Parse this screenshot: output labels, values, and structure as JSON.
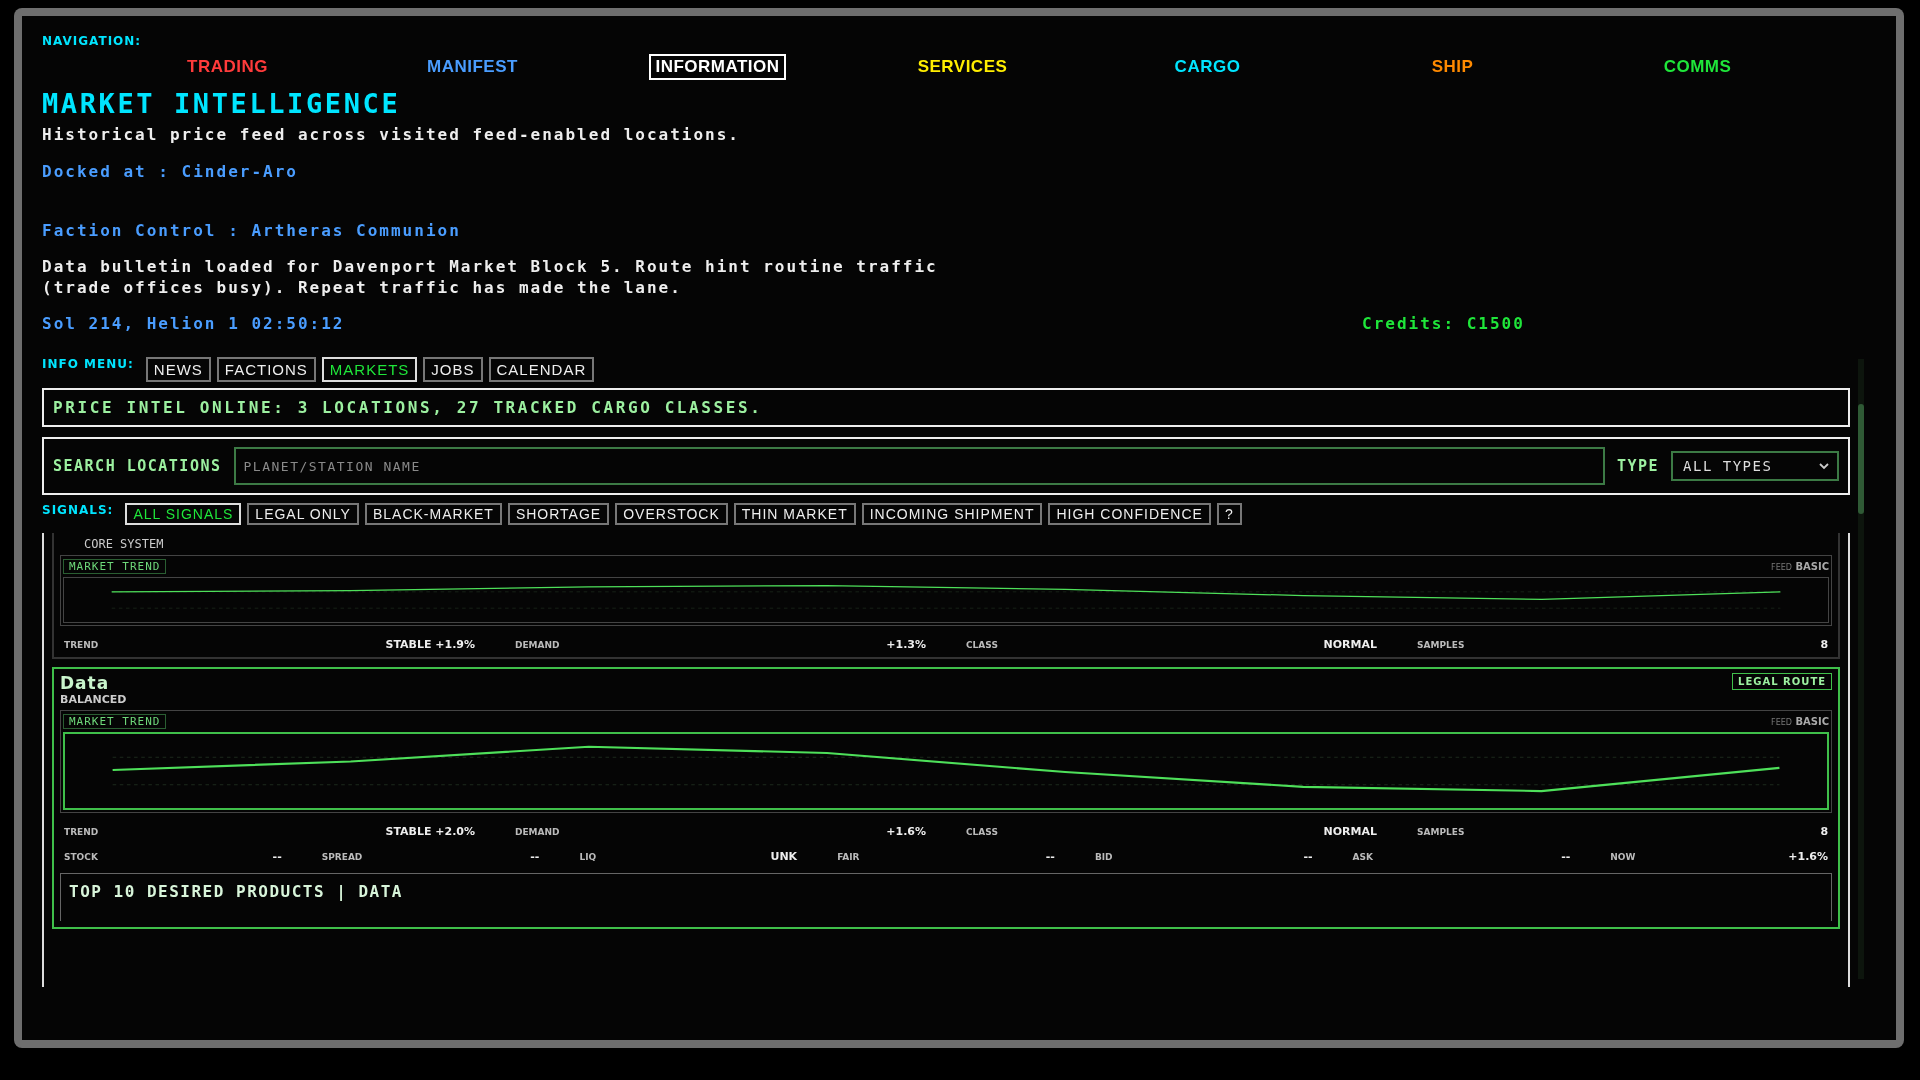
{
  "navigation": {
    "label": "NAVIGATION:",
    "items": [
      {
        "label": "TRADING",
        "color": "#ff3b3b",
        "selected": false
      },
      {
        "label": "MANIFEST",
        "color": "#4a9dff",
        "selected": false
      },
      {
        "label": "INFORMATION",
        "color": "#ffffff",
        "selected": true
      },
      {
        "label": "SERVICES",
        "color": "#ffee00",
        "selected": false
      },
      {
        "label": "CARGO",
        "color": "#00e5ff",
        "selected": false
      },
      {
        "label": "SHIP",
        "color": "#ff8a00",
        "selected": false
      },
      {
        "label": "COMMS",
        "color": "#1fe63a",
        "selected": false
      }
    ]
  },
  "header": {
    "title": "MARKET INTELLIGENCE",
    "subtitle": "Historical price feed across visited feed-enabled locations.",
    "docked": "Docked at : Cinder-Aro",
    "faction": "Faction Control : Artheras Communion",
    "bulletin": "Data bulletin loaded for Davenport Market Block 5. Route hint routine traffic (trade offices busy). Repeat traffic has made the lane.",
    "date": "Sol 214, Helion 1 02:50:12",
    "credits": "Credits: C1500"
  },
  "info_menu": {
    "label": "INFO MENU:",
    "tabs": [
      {
        "label": "NEWS",
        "selected": false
      },
      {
        "label": "FACTIONS",
        "selected": false
      },
      {
        "label": "MARKETS",
        "selected": true
      },
      {
        "label": "JOBS",
        "selected": false
      },
      {
        "label": "CALENDAR",
        "selected": false
      }
    ]
  },
  "banner": "PRICE INTEL ONLINE: 3 LOCATIONS, 27 TRACKED CARGO CLASSES.",
  "search": {
    "label": "SEARCH LOCATIONS",
    "placeholder": "PLANET/STATION NAME",
    "type_label": "TYPE",
    "type_value": "ALL TYPES"
  },
  "signals": {
    "label": "SIGNALS:",
    "filters": [
      {
        "label": "ALL SIGNALS",
        "selected": true
      },
      {
        "label": "LEGAL ONLY",
        "selected": false
      },
      {
        "label": "BLACK-MARKET",
        "selected": false
      },
      {
        "label": "SHORTAGE",
        "selected": false
      },
      {
        "label": "OVERSTOCK",
        "selected": false
      },
      {
        "label": "THIN MARKET",
        "selected": false
      },
      {
        "label": "INCOMING SHIPMENT",
        "selected": false
      },
      {
        "label": "HIGH CONFIDENCE",
        "selected": false
      }
    ],
    "help": "?"
  },
  "market_cards": [
    {
      "highlighted": false,
      "class": "CORE SYSTEM",
      "trend_label": "MARKET TREND",
      "feed_label": "FEED",
      "feed_value": "BASIC",
      "stat_rows": [
        [
          {
            "label": "TREND",
            "value": "STABLE +1.9%"
          },
          {
            "label": "DEMAND",
            "value": "+1.3%"
          },
          {
            "label": "CLASS",
            "value": "NORMAL"
          },
          {
            "label": "SAMPLES",
            "value": "8"
          }
        ]
      ]
    },
    {
      "highlighted": true,
      "name": "Data",
      "status": "BALANCED",
      "tag": "LEGAL ROUTE",
      "trend_label": "MARKET TREND",
      "feed_label": "FEED",
      "feed_value": "BASIC",
      "stat_rows": [
        [
          {
            "label": "TREND",
            "value": "STABLE +2.0%"
          },
          {
            "label": "DEMAND",
            "value": "+1.6%"
          },
          {
            "label": "CLASS",
            "value": "NORMAL"
          },
          {
            "label": "SAMPLES",
            "value": "8"
          }
        ],
        [
          {
            "label": "STOCK",
            "value": "--"
          },
          {
            "label": "SPREAD",
            "value": "--"
          },
          {
            "label": "LIQ",
            "value": "UNK"
          },
          {
            "label": "FAIR",
            "value": "--"
          },
          {
            "label": "BID",
            "value": "--"
          },
          {
            "label": "ASK",
            "value": "--"
          },
          {
            "label": "NOW",
            "value": "+1.6%"
          }
        ]
      ],
      "products_title": "TOP 10 DESIRED PRODUCTS | DATA"
    }
  ]
}
